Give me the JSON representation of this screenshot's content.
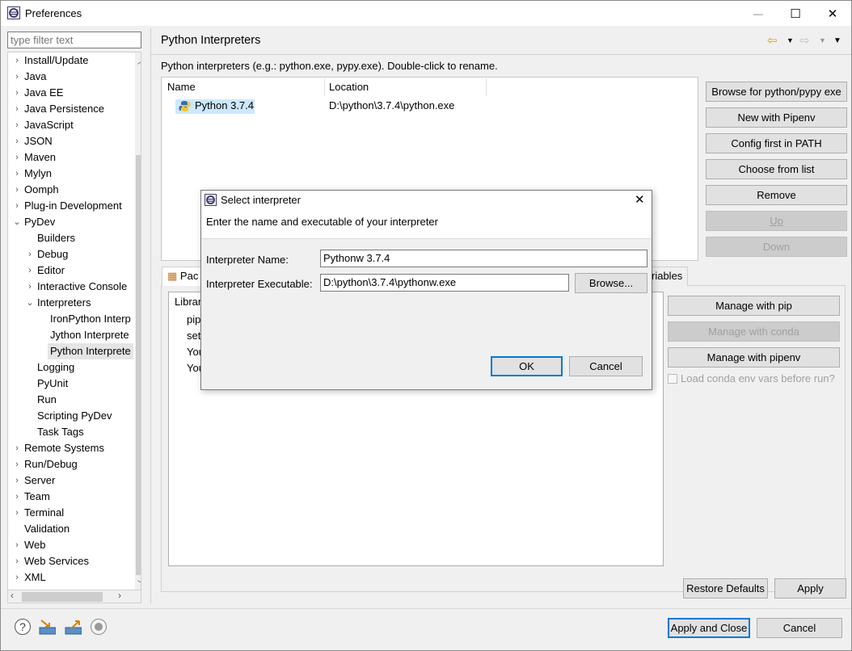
{
  "window": {
    "title": "Preferences",
    "controls": {
      "minimize": "—",
      "maximize": "☐",
      "close": "✕"
    }
  },
  "filter": {
    "placeholder": "type filter text"
  },
  "tree": {
    "items": [
      {
        "label": "Install/Update",
        "level": 0,
        "expander": "›"
      },
      {
        "label": "Java",
        "level": 0,
        "expander": "›"
      },
      {
        "label": "Java EE",
        "level": 0,
        "expander": "›"
      },
      {
        "label": "Java Persistence",
        "level": 0,
        "expander": "›"
      },
      {
        "label": "JavaScript",
        "level": 0,
        "expander": "›"
      },
      {
        "label": "JSON",
        "level": 0,
        "expander": "›"
      },
      {
        "label": "Maven",
        "level": 0,
        "expander": "›"
      },
      {
        "label": "Mylyn",
        "level": 0,
        "expander": "›"
      },
      {
        "label": "Oomph",
        "level": 0,
        "expander": "›"
      },
      {
        "label": "Plug-in Development",
        "level": 0,
        "expander": "›"
      },
      {
        "label": "PyDev",
        "level": 0,
        "expander": "⌄"
      },
      {
        "label": "Builders",
        "level": 1,
        "expander": ""
      },
      {
        "label": "Debug",
        "level": 1,
        "expander": "›"
      },
      {
        "label": "Editor",
        "level": 1,
        "expander": "›"
      },
      {
        "label": "Interactive Console",
        "level": 1,
        "expander": "›"
      },
      {
        "label": "Interpreters",
        "level": 1,
        "expander": "⌄"
      },
      {
        "label": "IronPython Interp",
        "level": 2,
        "expander": ""
      },
      {
        "label": "Jython Interprete",
        "level": 2,
        "expander": ""
      },
      {
        "label": "Python Interprete",
        "level": 2,
        "expander": "",
        "selected": true
      },
      {
        "label": "Logging",
        "level": 1,
        "expander": ""
      },
      {
        "label": "PyUnit",
        "level": 1,
        "expander": ""
      },
      {
        "label": "Run",
        "level": 1,
        "expander": ""
      },
      {
        "label": "Scripting PyDev",
        "level": 1,
        "expander": ""
      },
      {
        "label": "Task Tags",
        "level": 1,
        "expander": ""
      },
      {
        "label": "Remote Systems",
        "level": 0,
        "expander": "›"
      },
      {
        "label": "Run/Debug",
        "level": 0,
        "expander": "›"
      },
      {
        "label": "Server",
        "level": 0,
        "expander": "›"
      },
      {
        "label": "Team",
        "level": 0,
        "expander": "›"
      },
      {
        "label": "Terminal",
        "level": 0,
        "expander": "›"
      },
      {
        "label": "Validation",
        "level": 0,
        "expander": ""
      },
      {
        "label": "Web",
        "level": 0,
        "expander": "›"
      },
      {
        "label": "Web Services",
        "level": 0,
        "expander": "›"
      },
      {
        "label": "XML",
        "level": 0,
        "expander": "›"
      }
    ]
  },
  "page": {
    "title": "Python Interpreters",
    "description": "Python interpreters (e.g.: python.exe, pypy.exe).   Double-click to rename.",
    "table": {
      "columns": [
        "Name",
        "Location"
      ],
      "rows": [
        {
          "name": "Python 3.7.4",
          "location": "D:\\python\\3.7.4\\python.exe"
        }
      ]
    },
    "buttons": {
      "browse": "Browse for python/pypy exe",
      "pipenv": "New with Pipenv",
      "config_path": "Config first in PATH",
      "choose": "Choose from list",
      "remove": "Remove",
      "up": "Up",
      "down": "Down"
    },
    "tabs": {
      "packages": "Pac",
      "env": "riables"
    },
    "libraries": {
      "header": "Librar",
      "lines": [
        "pip",
        "set",
        "You",
        "You"
      ]
    },
    "manage": {
      "pip": "Manage with pip",
      "conda": "Manage with conda",
      "pipenv": "Manage with pipenv"
    },
    "conda_checkbox": "Load conda env vars before run?",
    "restore_defaults": "Restore Defaults",
    "apply": "Apply"
  },
  "footer": {
    "apply_close": "Apply and Close",
    "cancel": "Cancel"
  },
  "dialog": {
    "title": "Select interpreter",
    "message": "Enter the name and executable of your interpreter",
    "name_label": "Interpreter Name:",
    "name_value": "Pythonw 3.7.4",
    "exe_label": "Interpreter Executable:",
    "exe_value": "D:\\python\\3.7.4\\pythonw.exe",
    "browse": "Browse...",
    "ok": "OK",
    "cancel": "Cancel"
  },
  "colors": {
    "accent": "#0078d7",
    "selection": "#cce8ff"
  }
}
